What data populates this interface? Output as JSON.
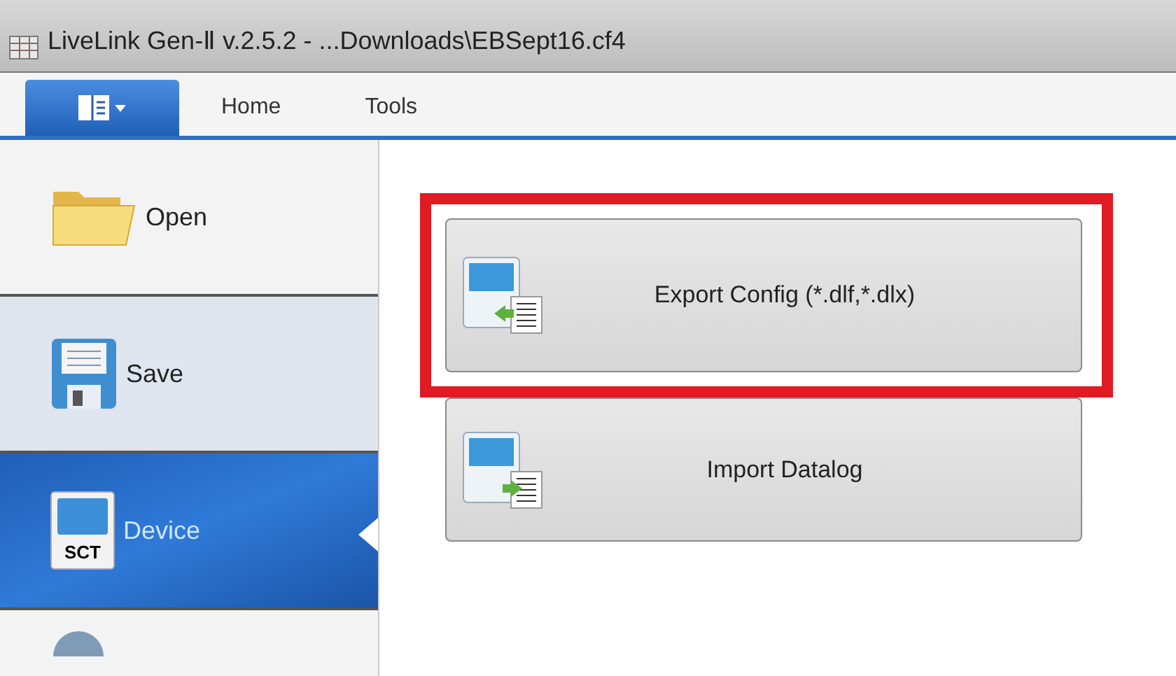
{
  "window": {
    "title": "LiveLink Gen-Ⅱ  v.2.5.2 - ...Downloads\\EBSept16.cf4"
  },
  "ribbon_tabs": [
    {
      "label": "Home",
      "selected": false
    },
    {
      "label": "Tools",
      "selected": false
    }
  ],
  "sidebar": {
    "items": [
      {
        "label": "Open",
        "kind": "open",
        "selected": false,
        "highlighted": false
      },
      {
        "label": "Save",
        "kind": "save",
        "selected": false,
        "highlighted": true
      },
      {
        "label": "Device",
        "kind": "device",
        "selected": true,
        "highlighted": false
      },
      {
        "kind": "more",
        "selected": false,
        "highlighted": false
      }
    ]
  },
  "device_icon_text": "SCT",
  "actions": [
    {
      "label": "Export Config (*.dlf,*.dlx)",
      "kind": "export",
      "outlined": true
    },
    {
      "label": "Import Datalog",
      "kind": "import",
      "outlined": false
    }
  ]
}
